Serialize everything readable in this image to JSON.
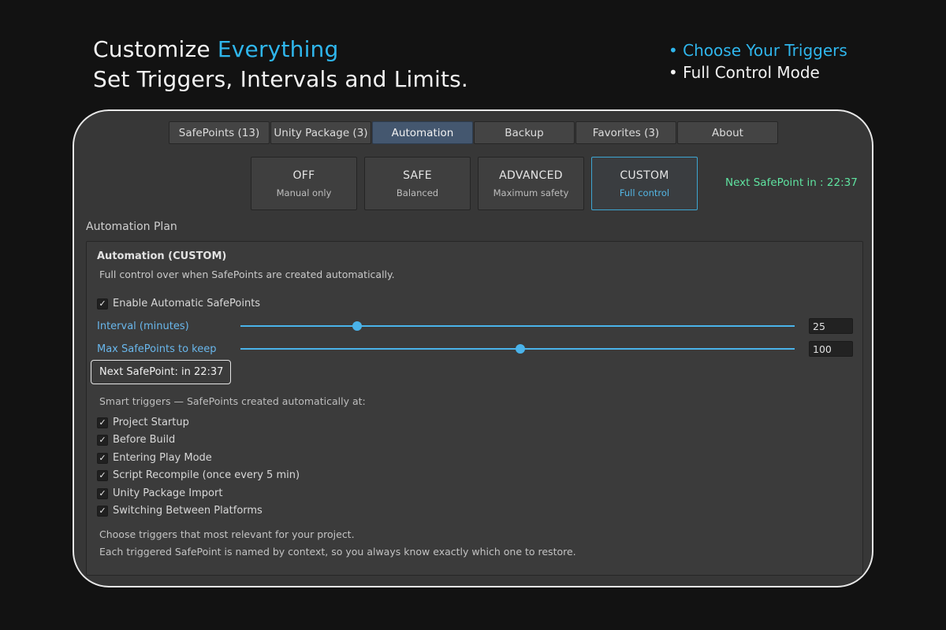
{
  "promo": {
    "headline_part1": "Customize ",
    "headline_accent": "Everything",
    "headline_line2": "Set Triggers, Intervals and Limits.",
    "bullet1": "• Choose Your Triggers",
    "bullet2": "• Full Control Mode"
  },
  "tabs": [
    {
      "label": "SafePoints (13)"
    },
    {
      "label": "Unity Package (3)"
    },
    {
      "label": "Automation",
      "active": true
    },
    {
      "label": "Backup"
    },
    {
      "label": "Favorites (3)"
    },
    {
      "label": "About"
    }
  ],
  "modes": [
    {
      "title": "OFF",
      "subtitle": "Manual only"
    },
    {
      "title": "SAFE",
      "subtitle": "Balanced"
    },
    {
      "title": "ADVANCED",
      "subtitle": "Maximum safety"
    },
    {
      "title": "CUSTOM",
      "subtitle": "Full control",
      "active": true
    }
  ],
  "next_safepoint_header": "Next SafePoint in : 22:37",
  "plan": {
    "section_label": "Automation Plan",
    "title": "Automation (CUSTOM)",
    "description": "Full control over when SafePoints are created automatically.",
    "enable_label": "Enable Automatic SafePoints",
    "enable_checked": true,
    "interval": {
      "label": "Interval (minutes)",
      "value": "25",
      "fraction": 0.21
    },
    "max_keep": {
      "label": "Max SafePoints to keep",
      "value": "100",
      "fraction": 0.505
    },
    "next_box": "Next SafePoint: in 22:37",
    "smart_label": "Smart triggers — SafePoints created automatically at:",
    "triggers": [
      {
        "label": "Project Startup",
        "checked": true
      },
      {
        "label": "Before Build",
        "checked": true
      },
      {
        "label": "Entering Play Mode",
        "checked": true
      },
      {
        "label": "Script Recompile (once every 5 min)",
        "checked": true
      },
      {
        "label": "Unity Package Import",
        "checked": true
      },
      {
        "label": "Switching Between Platforms",
        "checked": true
      }
    ],
    "footer1": "Choose triggers that most relevant for your project.",
    "footer2": "Each triggered SafePoint is named by context, so you always know exactly which one to restore."
  },
  "colors": {
    "accent": "#2fb6ec",
    "slider": "#4ab3ea",
    "next_green": "#5fe3a0"
  },
  "icons": {
    "check": "checkmark-icon"
  }
}
